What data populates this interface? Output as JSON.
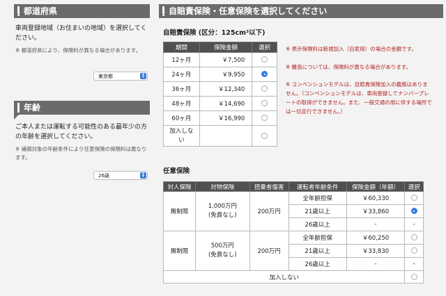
{
  "prefecture": {
    "title": "都道府県",
    "desc": "車両登録地域（お住まいの地域）を選択してください。",
    "note": "※ 都道府県により、保険料が異なる場合があります。",
    "select_value": "東京都"
  },
  "age": {
    "title": "年齢",
    "desc": "ご本人または運転する可能性のある最年少の方の年齢を選択してください。",
    "note": "※ 補償対象の年齢条件により任意保険の保険料は異なります。",
    "select_value": "26歳"
  },
  "main": {
    "title": "自賠責保険・任意保険を選択してください",
    "jibaiseki": {
      "heading": "自賠責保険 (区分：125cm³以下)",
      "headers": [
        "期間",
        "保険金額",
        "選択"
      ],
      "rows": [
        {
          "period": "12ヶ月",
          "amount": "￥7,500",
          "selected": false
        },
        {
          "period": "24ヶ月",
          "amount": "￥9,950",
          "selected": true
        },
        {
          "period": "36ヶ月",
          "amount": "￥12,340",
          "selected": false
        },
        {
          "period": "48ヶ月",
          "amount": "￥14,690",
          "selected": false
        },
        {
          "period": "60ヶ月",
          "amount": "￥16,990",
          "selected": false
        },
        {
          "period": "加入しない",
          "amount": "",
          "selected": false
        }
      ],
      "notes": [
        "※ 表示保険料は新規加入（自家用）の場合の金額です。",
        "※ 離島については、保険料が異なる場合があります。",
        "※ コンベンションモデルは、自賠責保険加入の義務はありません。（コンベンションモデルは、車両登録してナンバープレートの取得ができません。また、一般交通の用に供する場所では一切走行できません。）"
      ]
    },
    "nini": {
      "heading": "任意保険",
      "headers": [
        "対人保険",
        "対物保険",
        "搭乗者傷害",
        "運転者年齢条件",
        "保険金額（年額）",
        "選択"
      ],
      "groups": [
        {
          "taijin": "無制限",
          "taibutsu_line1": "1,000万円",
          "taibutsu_line2": "(免責なし)",
          "tojo": "200万円",
          "rows": [
            {
              "cond": "全年齢担保",
              "amount": "￥60,330",
              "selected": false
            },
            {
              "cond": "21歳以上",
              "amount": "￥33,860",
              "selected": true
            },
            {
              "cond": "26歳以上",
              "amount": "-",
              "selected": null
            }
          ]
        },
        {
          "taijin": "無制限",
          "taibutsu_line1": "500万円",
          "taibutsu_line2": "(免責なし)",
          "tojo": "200万円",
          "rows": [
            {
              "cond": "全年齢担保",
              "amount": "￥60,250",
              "selected": false
            },
            {
              "cond": "21歳以上",
              "amount": "￥33,830",
              "selected": false
            },
            {
              "cond": "26歳以上",
              "amount": "-",
              "selected": null
            }
          ]
        }
      ],
      "none_label": "加入しない"
    }
  }
}
